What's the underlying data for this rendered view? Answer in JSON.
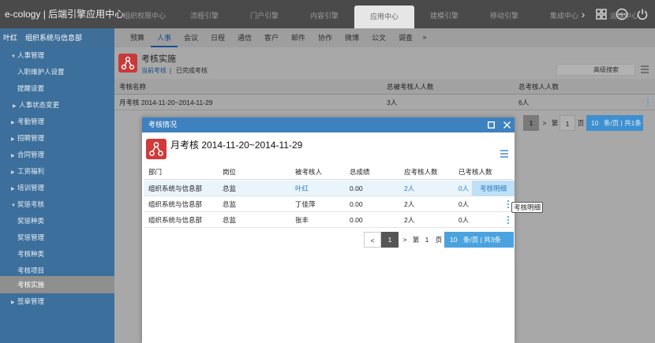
{
  "app": {
    "title": "e-cology | 后端引擎应用中心"
  },
  "top_tabs": [
    "组织权限中心",
    "流程引擎",
    "门户引擎",
    "内容引擎",
    "应用中心",
    "建模引擎",
    "移动引擎",
    "集成中心",
    "运维中心"
  ],
  "top_tabs_next": "›",
  "user": {
    "name": "叶红",
    "dept": "组织系统与信息部"
  },
  "sub_tabs": [
    "预算",
    "人事",
    "会议",
    "日程",
    "通信",
    "客户",
    "邮件",
    "协作",
    "微博",
    "公文",
    "调查"
  ],
  "sub_tabs_more": "»",
  "sidebar": {
    "items": [
      {
        "label": "人事管理",
        "level": "top",
        "expanded": true
      },
      {
        "label": "入职维护人设置",
        "level": "child"
      },
      {
        "label": "提醒设置",
        "level": "child"
      },
      {
        "label": "人事状态变更",
        "level": "child",
        "collapsed": true
      },
      {
        "label": "考勤管理",
        "level": "top"
      },
      {
        "label": "招聘管理",
        "level": "top"
      },
      {
        "label": "合同管理",
        "level": "top"
      },
      {
        "label": "工资福利",
        "level": "top"
      },
      {
        "label": "培训管理",
        "level": "top"
      },
      {
        "label": "奖惩考核",
        "level": "top",
        "expanded": true
      },
      {
        "label": "奖惩种类",
        "level": "child"
      },
      {
        "label": "奖惩管理",
        "level": "child"
      },
      {
        "label": "考核种类",
        "level": "child"
      },
      {
        "label": "考核项目",
        "level": "child"
      },
      {
        "label": "考核实施",
        "level": "child",
        "active": true
      },
      {
        "label": "签章管理",
        "level": "top"
      }
    ]
  },
  "page": {
    "title": "考核实施",
    "filter_current": "当前考核",
    "filter_separator": "|",
    "filter_done": "已完成考核",
    "search_label": "高级搜索",
    "columns": [
      "考核名称",
      "总被考核人人数",
      "总考核人人数"
    ],
    "rows": [
      {
        "name": "月考核 2014-11-20~2014-11-29",
        "total_assessed": "3人",
        "total_assessors": "6人"
      }
    ],
    "pager": {
      "prev": "<",
      "current": "1",
      "next": ">",
      "page_prefix": "第",
      "page_num": "1",
      "page_suffix": "页",
      "per_page": "10",
      "summary": "条/页 | 共1条"
    }
  },
  "modal": {
    "bar_title": "考核情况",
    "title": "月考核 2014-11-20~2014-11-29",
    "columns": [
      "部门",
      "岗位",
      "被考核人",
      "总成绩",
      "应考核人数",
      "已考核人数"
    ],
    "rows": [
      {
        "dept": "组织系统与信息部",
        "post": "总监",
        "person": "叶红",
        "score": "0.00",
        "should": "2人",
        "done": "0人"
      },
      {
        "dept": "组织系统与信息部",
        "post": "总监",
        "person": "丁佳萍",
        "score": "0.00",
        "should": "2人",
        "done": "0人"
      },
      {
        "dept": "组织系统与信息部",
        "post": "总监",
        "person": "张丰",
        "score": "0.00",
        "should": "2人",
        "done": "0人"
      }
    ],
    "detail_button": "考核明细",
    "tooltip": "考核明细",
    "pager": {
      "prev": "<",
      "current": "1",
      "next": ">",
      "page_prefix": "第",
      "page_num": "1",
      "page_suffix": "页",
      "per_page": "10",
      "summary": "条/页 | 共3条"
    }
  },
  "colors": {
    "accent": "#3e81c0",
    "sidebar": "#3c6f9b",
    "topbar": "#4a4a4a",
    "logo": "#d03a3a",
    "link": "#2a7bc8"
  }
}
